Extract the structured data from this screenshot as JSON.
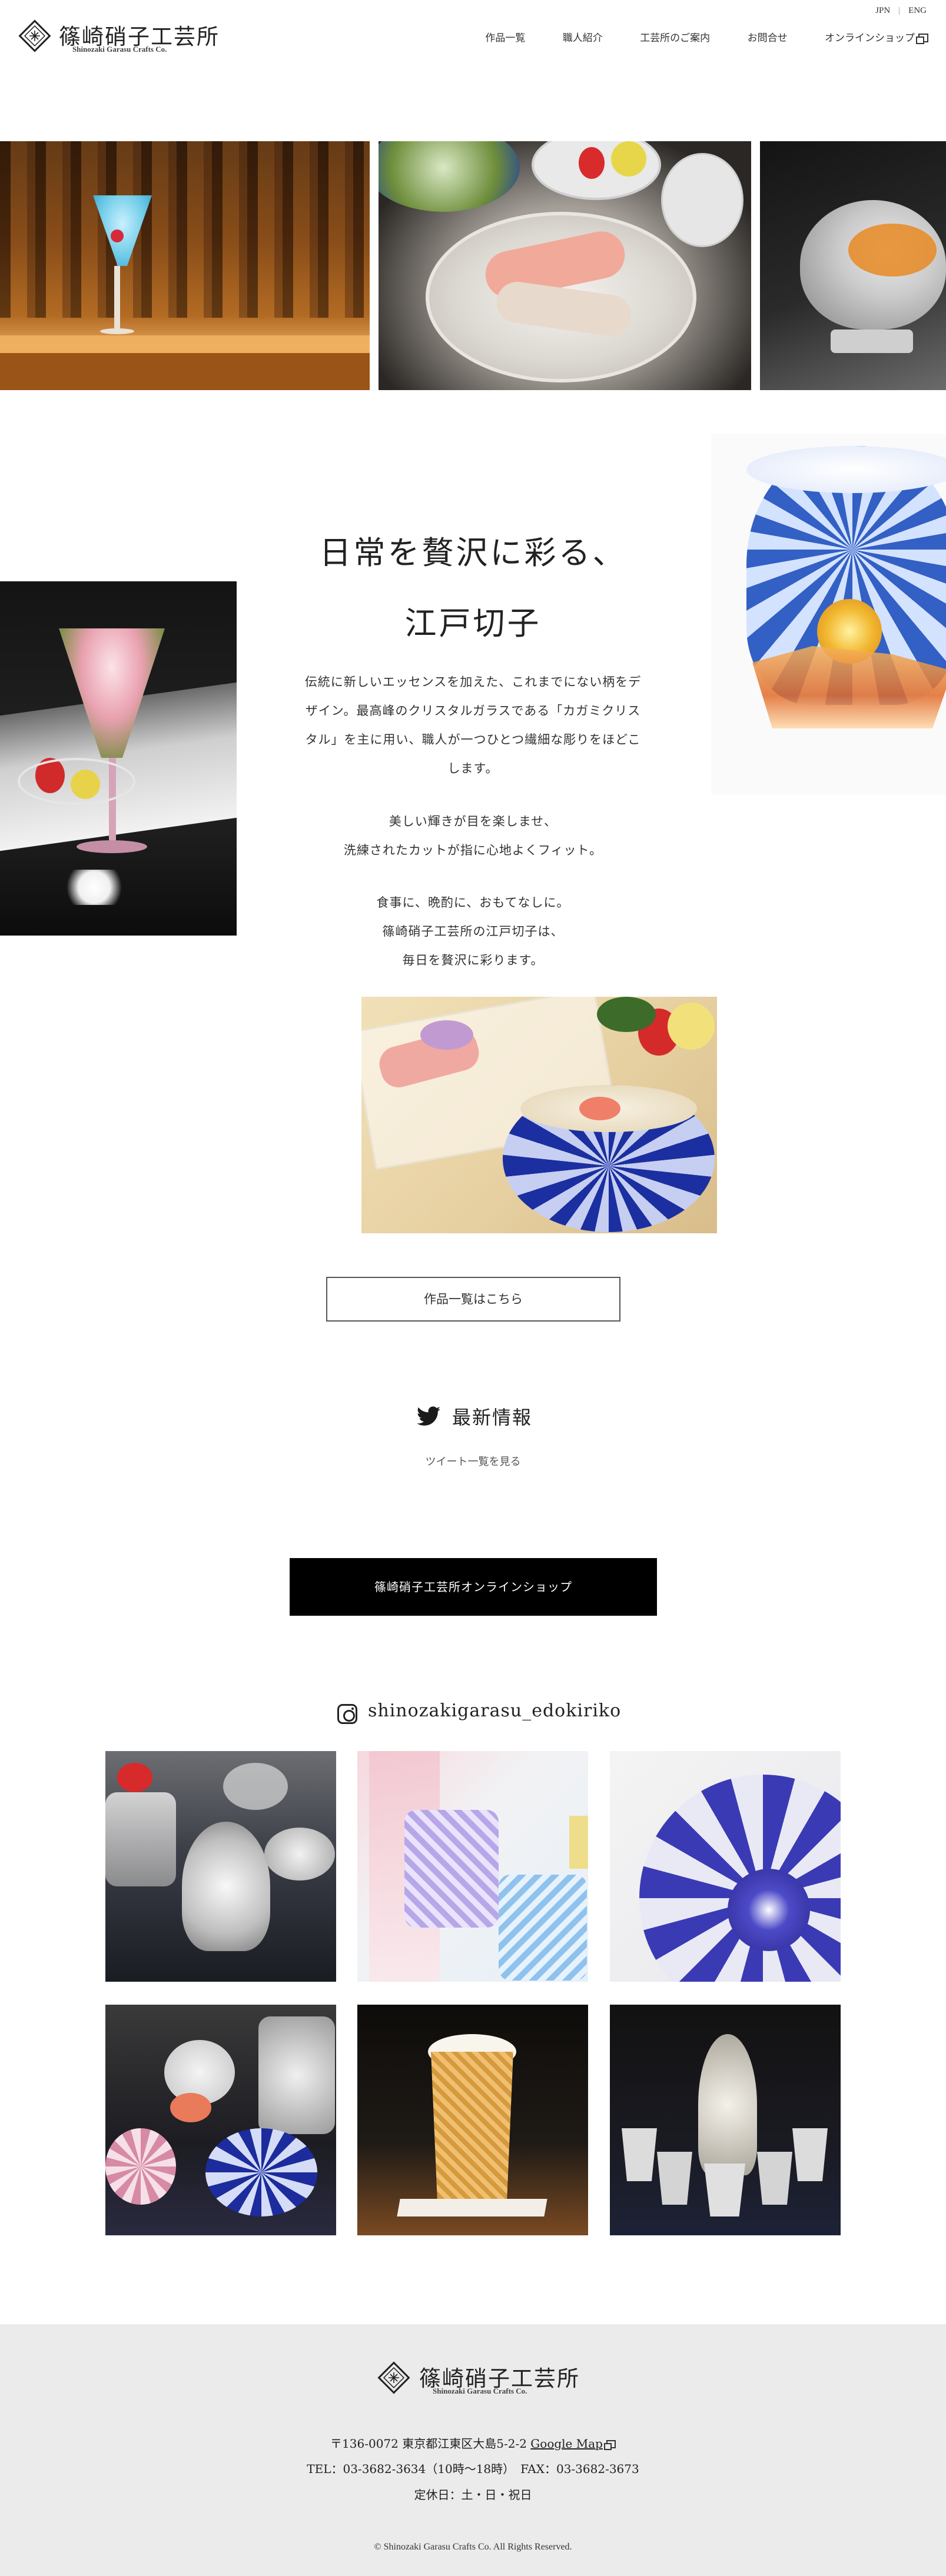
{
  "header": {
    "logo_title": "篠崎硝子工芸所",
    "logo_sub": "Shinozaki Garasu Crafts Co.",
    "lang": [
      "JPN",
      "ENG"
    ],
    "nav": [
      "作品一覧",
      "職人紹介",
      "工芸所のご案内",
      "お問合せ",
      "オンラインショップ"
    ]
  },
  "intro": {
    "heading_line1": "日常を贅沢に彩る、",
    "heading_line2": "江戸切子",
    "para1": [
      "伝統に新しいエッセンスを加えた、これまでにない柄をデ",
      "ザイン。最高峰のクリスタルガラスである「カガミクリス",
      "タル」を主に用い、職人が一つひとつ繊細な彫りをほどこ",
      "します。"
    ],
    "para2": [
      "美しい輝きが目を楽しませ、",
      "洗練されたカットが指に心地よくフィット。"
    ],
    "para3": [
      "食事に、晩酌に、おもてなしに。",
      "篠崎硝子工芸所の江戸切子は、",
      "毎日を贅沢に彩ります。"
    ],
    "works_button": "作品一覧はこちら"
  },
  "twitter": {
    "title": "最新情報",
    "link": "ツイート一覧を見る",
    "icon": "twitter-bird-icon"
  },
  "shop_button": "篠崎硝子工芸所オンラインショップ",
  "instagram": {
    "handle": "shinozakigarasu_edokiriko",
    "icon": "instagram-icon"
  },
  "footer": {
    "logo_title": "篠崎硝子工芸所",
    "logo_sub": "Shinozaki Garasu Crafts Co.",
    "address": "〒136-0072 東京都江東区大島5-2-2",
    "map_link": "Google Map",
    "tel": "TEL：03-3682-3634（10時〜18時）　FAX：03-3682-3673",
    "holiday": "定休日：土・日・祝日",
    "copyright": "© Shinozaki Garasu Crafts Co. All Rights Reserved."
  },
  "colors": {
    "text": "#333333",
    "shop_button_bg": "#000000",
    "footer_bg": "#ebebeb"
  }
}
